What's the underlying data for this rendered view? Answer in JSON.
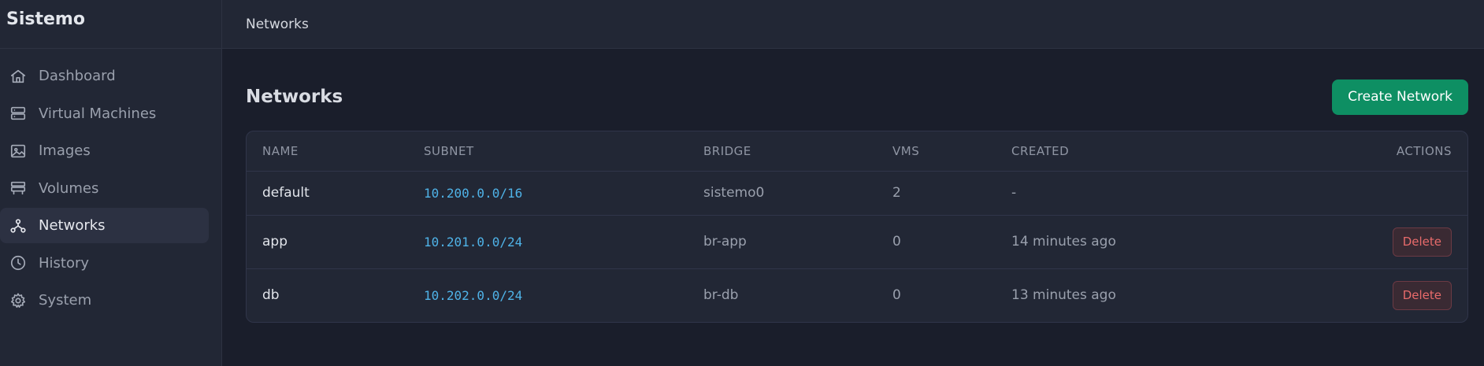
{
  "brand": "Sistemo",
  "sidebar": {
    "items": [
      {
        "label": "Dashboard",
        "icon": "home-icon",
        "active": false
      },
      {
        "label": "Virtual Machines",
        "icon": "server-icon",
        "active": false
      },
      {
        "label": "Images",
        "icon": "image-icon",
        "active": false
      },
      {
        "label": "Volumes",
        "icon": "database-icon",
        "active": false
      },
      {
        "label": "Networks",
        "icon": "network-icon",
        "active": true
      },
      {
        "label": "History",
        "icon": "clock-icon",
        "active": false
      },
      {
        "label": "System",
        "icon": "gear-icon",
        "active": false
      }
    ]
  },
  "topbar": {
    "breadcrumb": "Networks"
  },
  "main": {
    "title": "Networks",
    "create_label": "Create Network",
    "columns": [
      "NAME",
      "SUBNET",
      "BRIDGE",
      "VMS",
      "CREATED",
      "ACTIONS"
    ],
    "rows": [
      {
        "name": "default",
        "subnet": "10.200.0.0/16",
        "bridge": "sistemo0",
        "vms": "2",
        "created": "-",
        "action": ""
      },
      {
        "name": "app",
        "subnet": "10.201.0.0/24",
        "bridge": "br-app",
        "vms": "0",
        "created": "14 minutes ago",
        "action": "Delete"
      },
      {
        "name": "db",
        "subnet": "10.202.0.0/24",
        "bridge": "br-db",
        "vms": "0",
        "created": "13 minutes ago",
        "action": "Delete"
      }
    ]
  },
  "colors": {
    "accent": "#0e8f63",
    "subnet": "#4fb3e8",
    "danger": "#e86b6b",
    "background": "#1a1e2b",
    "panel": "#222735"
  }
}
